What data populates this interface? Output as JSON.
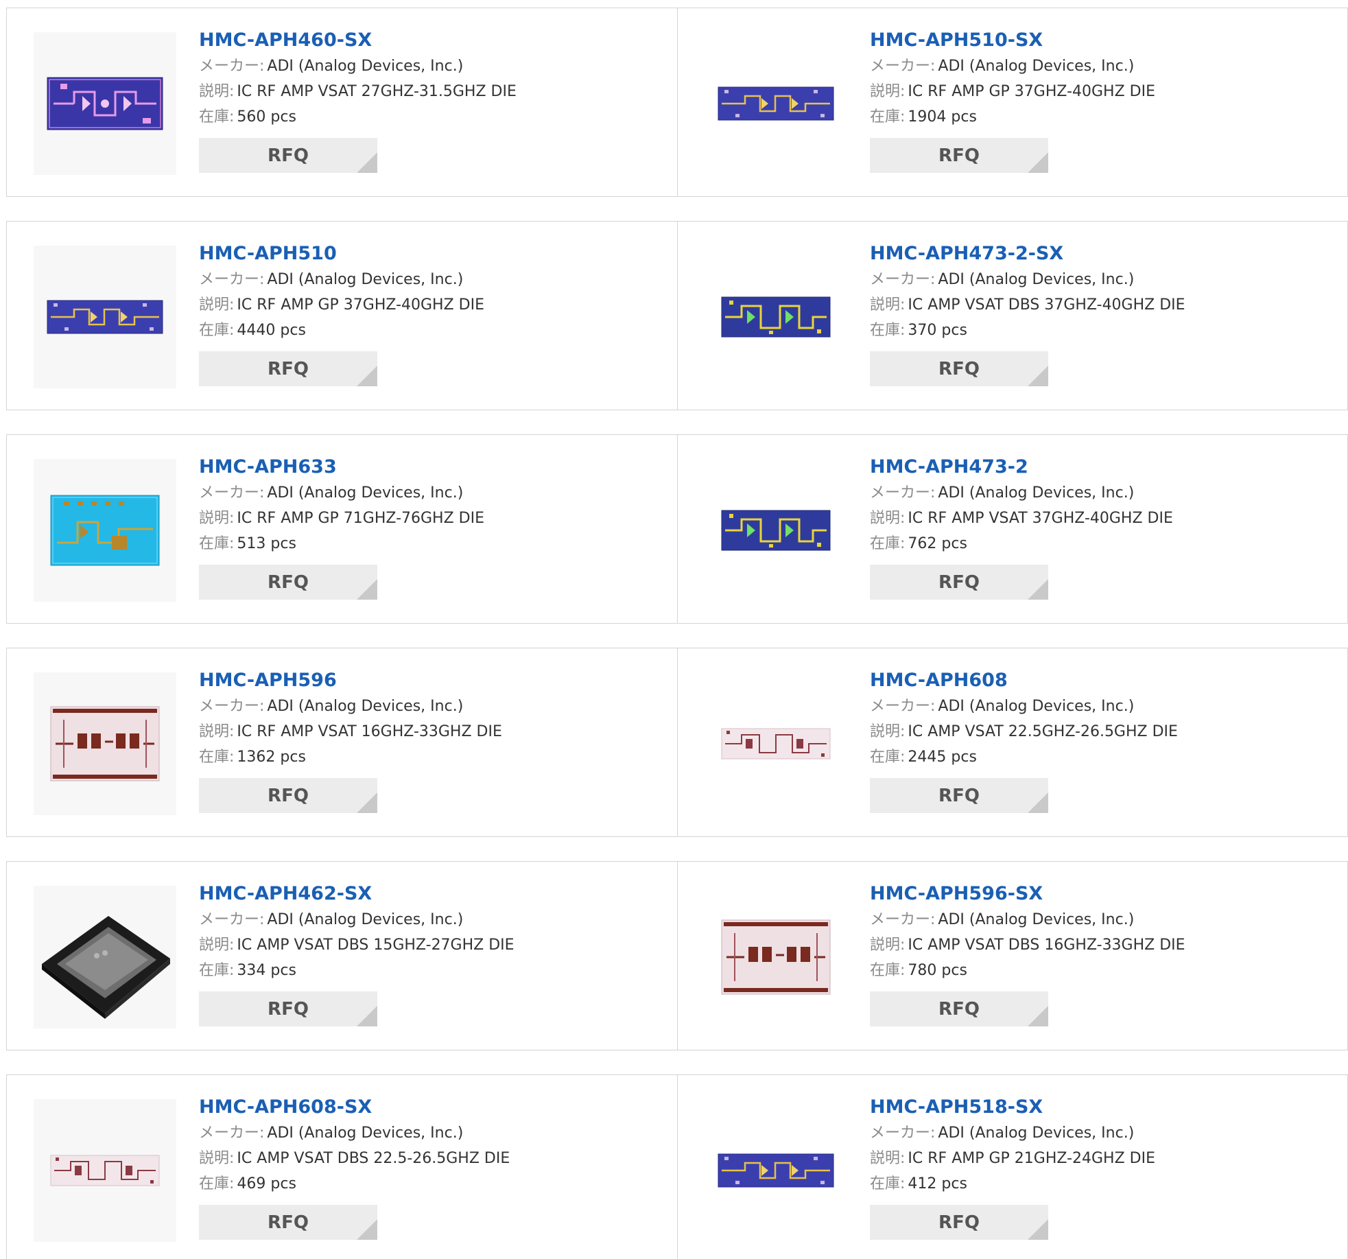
{
  "labels": {
    "maker": "メーカー:",
    "desc": "説明:",
    "stock": "在庫:"
  },
  "rows": [
    {
      "cards": [
        {
          "part": "HMC-APH460-SX",
          "maker": "ADI (Analog Devices, Inc.)",
          "desc": "IC RF AMP VSAT 27GHZ-31.5GHZ DIE",
          "stock": "560 pcs",
          "rfq": "RFQ",
          "image": "chip-die-purple-image"
        },
        {
          "part": "HMC-APH510-SX",
          "maker": "ADI (Analog Devices, Inc.)",
          "desc": "IC RF AMP GP 37GHZ-40GHZ DIE",
          "stock": "1904 pcs",
          "rfq": "RFQ",
          "image": "chip-die-blue-strip-image"
        }
      ]
    },
    {
      "cards": [
        {
          "part": "HMC-APH510",
          "maker": "ADI (Analog Devices, Inc.)",
          "desc": "IC RF AMP GP 37GHZ-40GHZ DIE",
          "stock": "4440 pcs",
          "rfq": "RFQ",
          "image": "chip-die-blue-strip-image"
        },
        {
          "part": "HMC-APH473-2-SX",
          "maker": "ADI (Analog Devices, Inc.)",
          "desc": "IC AMP VSAT DBS 37GHZ-40GHZ DIE",
          "stock": "370 pcs",
          "rfq": "RFQ",
          "image": "chip-die-blue-yellow-image"
        }
      ]
    },
    {
      "cards": [
        {
          "part": "HMC-APH633",
          "maker": "ADI (Analog Devices, Inc.)",
          "desc": "IC RF AMP GP 71GHZ-76GHZ DIE",
          "stock": "513 pcs",
          "rfq": "RFQ",
          "image": "chip-die-cyan-image"
        },
        {
          "part": "HMC-APH473-2",
          "maker": "ADI (Analog Devices, Inc.)",
          "desc": "IC RF AMP VSAT 37GHZ-40GHZ DIE",
          "stock": "762 pcs",
          "rfq": "RFQ",
          "image": "chip-die-blue-yellow-image"
        }
      ]
    },
    {
      "cards": [
        {
          "part": "HMC-APH596",
          "maker": "ADI (Analog Devices, Inc.)",
          "desc": "IC RF AMP VSAT 16GHZ-33GHZ DIE",
          "stock": "1362 pcs",
          "rfq": "RFQ",
          "image": "chip-die-pink-image"
        },
        {
          "part": "HMC-APH608",
          "maker": "ADI (Analog Devices, Inc.)",
          "desc": "IC AMP VSAT 22.5GHZ-26.5GHZ DIE",
          "stock": "2445 pcs",
          "rfq": "RFQ",
          "image": "chip-die-pink-strip-image"
        }
      ]
    },
    {
      "cards": [
        {
          "part": "HMC-APH462-SX",
          "maker": "ADI (Analog Devices, Inc.)",
          "desc": "IC AMP VSAT DBS 15GHZ-27GHZ DIE",
          "stock": "334 pcs",
          "rfq": "RFQ",
          "image": "chip-package-black-image"
        },
        {
          "part": "HMC-APH596-SX",
          "maker": "ADI (Analog Devices, Inc.)",
          "desc": "IC AMP VSAT DBS 16GHZ-33GHZ DIE",
          "stock": "780 pcs",
          "rfq": "RFQ",
          "image": "chip-die-pink-image"
        }
      ]
    },
    {
      "cards": [
        {
          "part": "HMC-APH608-SX",
          "maker": "ADI (Analog Devices, Inc.)",
          "desc": "IC AMP VSAT DBS 22.5-26.5GHZ DIE",
          "stock": "469 pcs",
          "rfq": "RFQ",
          "image": "chip-die-pink-strip-image"
        },
        {
          "part": "HMC-APH518-SX",
          "maker": "ADI (Analog Devices, Inc.)",
          "desc": "IC RF AMP GP 21GHZ-24GHZ DIE",
          "stock": "412 pcs",
          "rfq": "RFQ",
          "image": "chip-die-blue-strip-image"
        }
      ]
    }
  ]
}
